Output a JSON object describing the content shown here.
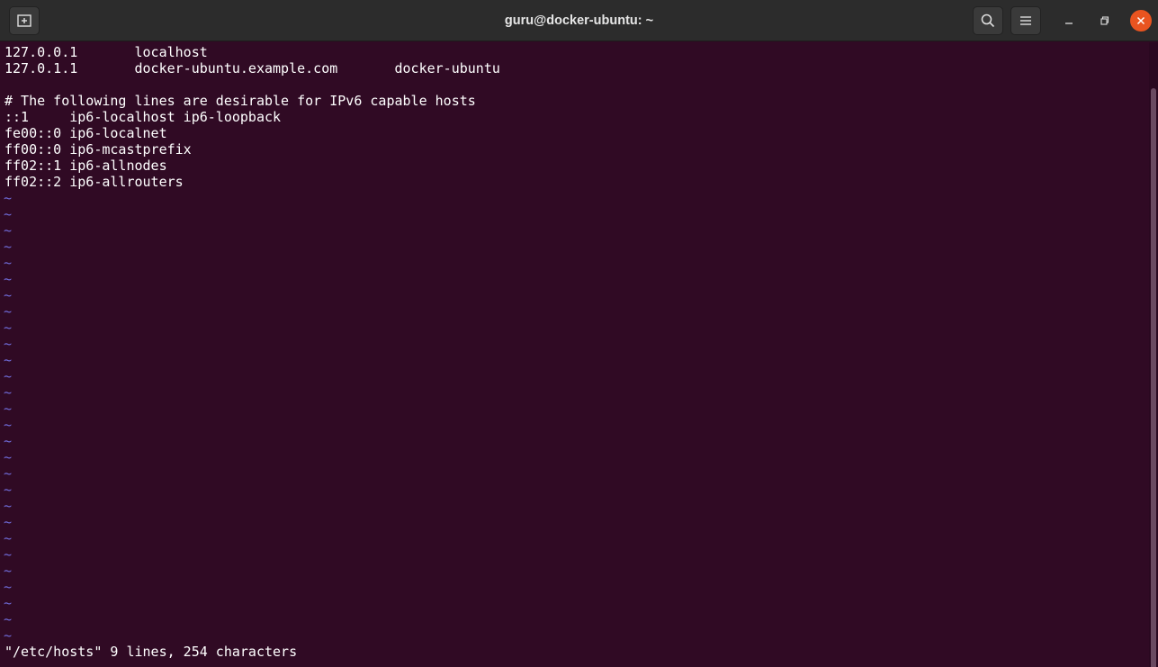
{
  "window": {
    "title": "guru@docker-ubuntu: ~",
    "icons": {
      "new_tab": "new-tab-icon",
      "search": "search-icon",
      "menu": "hamburger-menu-icon",
      "minimize": "minimize-icon",
      "maximize": "maximize-icon",
      "close": "close-icon"
    },
    "colors": {
      "titlebar": "#2c2c2c",
      "terminal_bg": "#300a24",
      "close_button": "#e95420",
      "tilde": "#6f6bd8"
    }
  },
  "editor": {
    "lines": [
      "127.0.0.1       localhost",
      "127.0.1.1       docker-ubuntu.example.com       docker-ubuntu",
      "",
      "# The following lines are desirable for IPv6 capable hosts",
      "::1     ip6-localhost ip6-loopback",
      "fe00::0 ip6-localnet",
      "ff00::0 ip6-mcastprefix",
      "ff02::1 ip6-allnodes",
      "ff02::2 ip6-allrouters"
    ],
    "empty_line_marker": "~",
    "status_line": "\"/etc/hosts\" 9 lines, 254 characters"
  }
}
